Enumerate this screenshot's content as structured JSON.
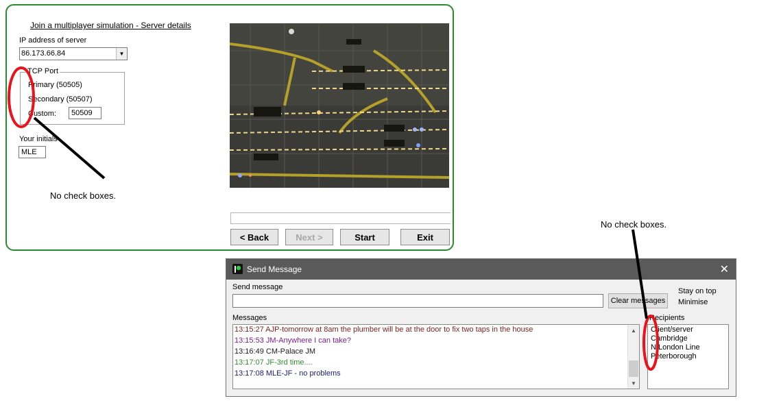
{
  "server_details": {
    "title": "Join a multiplayer simulation - Server details",
    "ip_label": "IP address of server",
    "ip_value": "86.173.66.84",
    "port_group_label": "TCP Port",
    "port_primary": "Primary (50505)",
    "port_secondary": "Secondary (50507)",
    "port_custom": "Custom:",
    "port_custom_value": "50509",
    "initials_label": "Your initials",
    "initials_value": "MLE",
    "buttons": {
      "back": "< Back",
      "next": "Next >",
      "start": "Start",
      "exit": "Exit"
    }
  },
  "send_message": {
    "window_title": "Send Message",
    "send_label": "Send message",
    "input_value": "",
    "clear_button": "Clear messages",
    "stay_on_top": "Stay on top",
    "minimise": "Minimise",
    "messages_label": "Messages",
    "messages": [
      {
        "text": "13:15:27 AJP-tomorrow at 8am the plumber will be at the door to fix two taps in the house",
        "color": "#7b1e1e"
      },
      {
        "text": "13:15:53 JM-Anywhere I can take?",
        "color": "#7a1f8a"
      },
      {
        "text": "13:16:49 CM-Palace JM",
        "color": "#1a1a1a"
      },
      {
        "text": "13:17:07 JF-3rd time....",
        "color": "#2f8a2f"
      },
      {
        "text": "13:17:08 MLE-JF - no problems",
        "color": "#1a1a6e"
      }
    ],
    "recipients_label": "Recipients",
    "recipients": [
      "Client/server",
      "Cambridge",
      "N London Line",
      "Peterborough"
    ]
  },
  "annotations": {
    "note_1": "No check boxes.",
    "note_2": "No check boxes.",
    "marker_color": "#e8131b",
    "pointer_color": "#000000"
  },
  "colors": {
    "panel_border": "#2b8a2b",
    "titlebar": "#5a5a5a"
  }
}
